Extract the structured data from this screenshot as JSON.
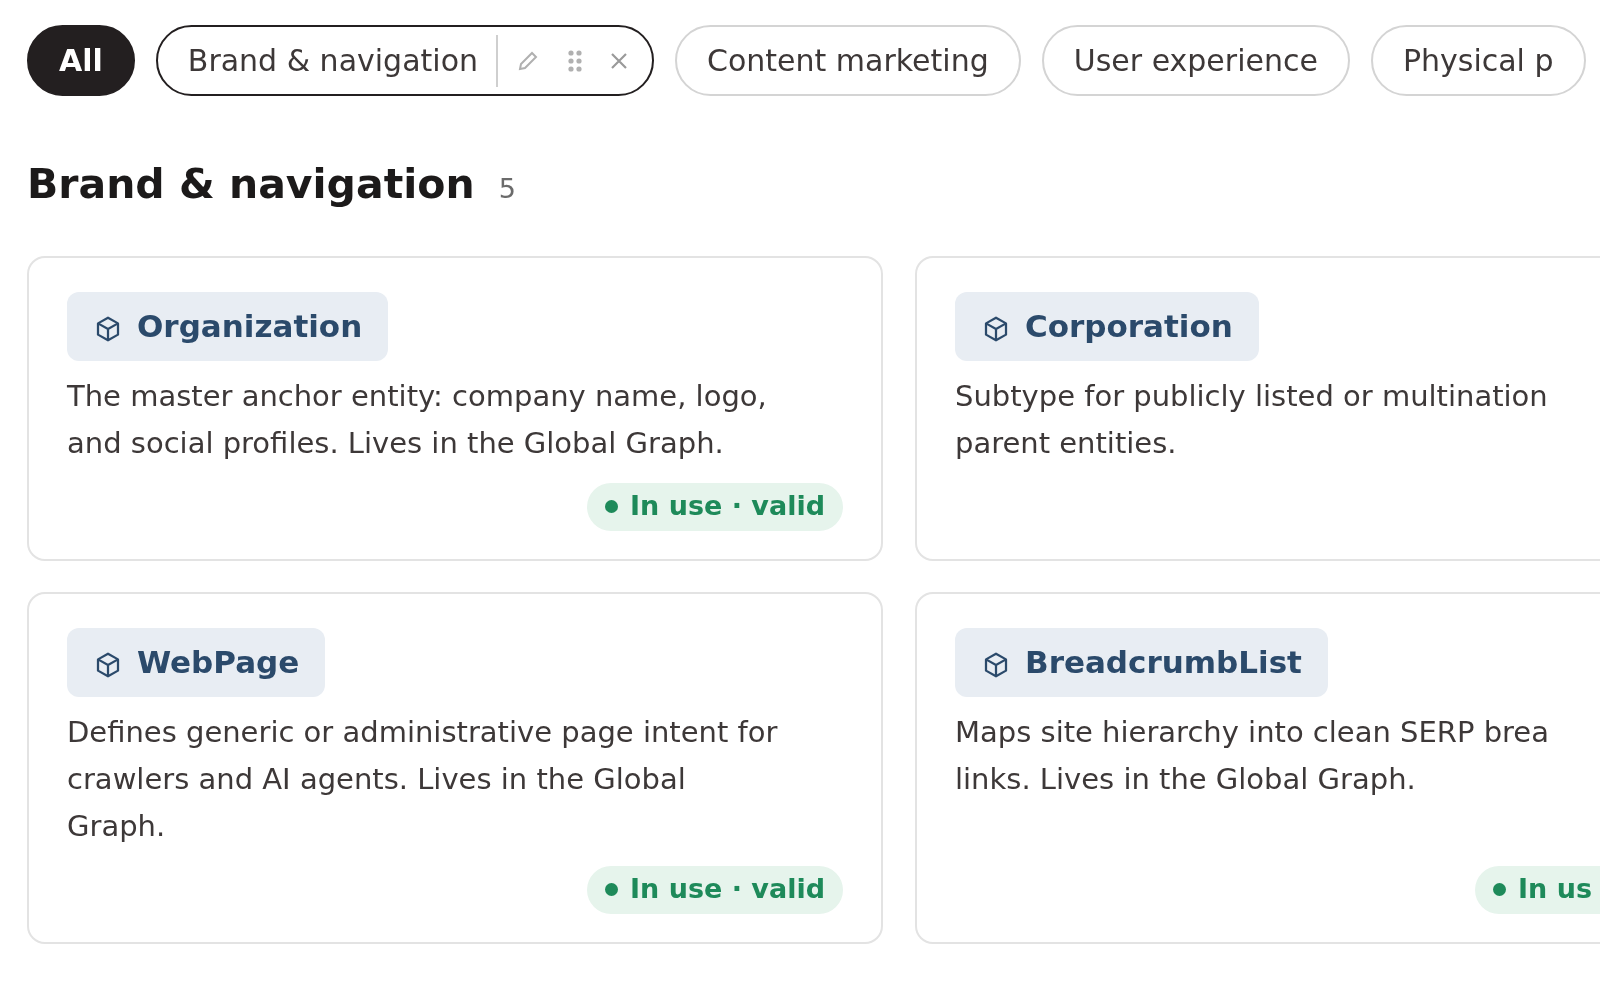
{
  "filters": [
    {
      "label": "All",
      "selected": true,
      "editable": false
    },
    {
      "label": "Brand & navigation",
      "selected": false,
      "editable": true
    },
    {
      "label": "Content marketing",
      "selected": false,
      "editable": false
    },
    {
      "label": "User experience",
      "selected": false,
      "editable": false
    },
    {
      "label": "Physical p",
      "selected": false,
      "editable": false
    }
  ],
  "section": {
    "title": "Brand & navigation",
    "count": "5"
  },
  "cards": [
    {
      "name": "Organization",
      "description": [
        "The master anchor entity: company name, logo,",
        "and social profiles. Lives in the Global Graph."
      ],
      "status": "In use · valid"
    },
    {
      "name": "Corporation",
      "description": [
        "Subtype for publicly listed or multination",
        "parent entities."
      ]
    },
    {
      "name": "WebPage",
      "description": [
        "Defines generic or administrative page intent for",
        "crawlers and AI agents. Lives in the Global",
        "Graph."
      ],
      "status": "In use · valid"
    },
    {
      "name": "BreadcrumbList",
      "description": [
        "Maps site hierarchy into clean SERP brea",
        "links. Lives in the Global Graph."
      ],
      "status": "In us"
    }
  ]
}
